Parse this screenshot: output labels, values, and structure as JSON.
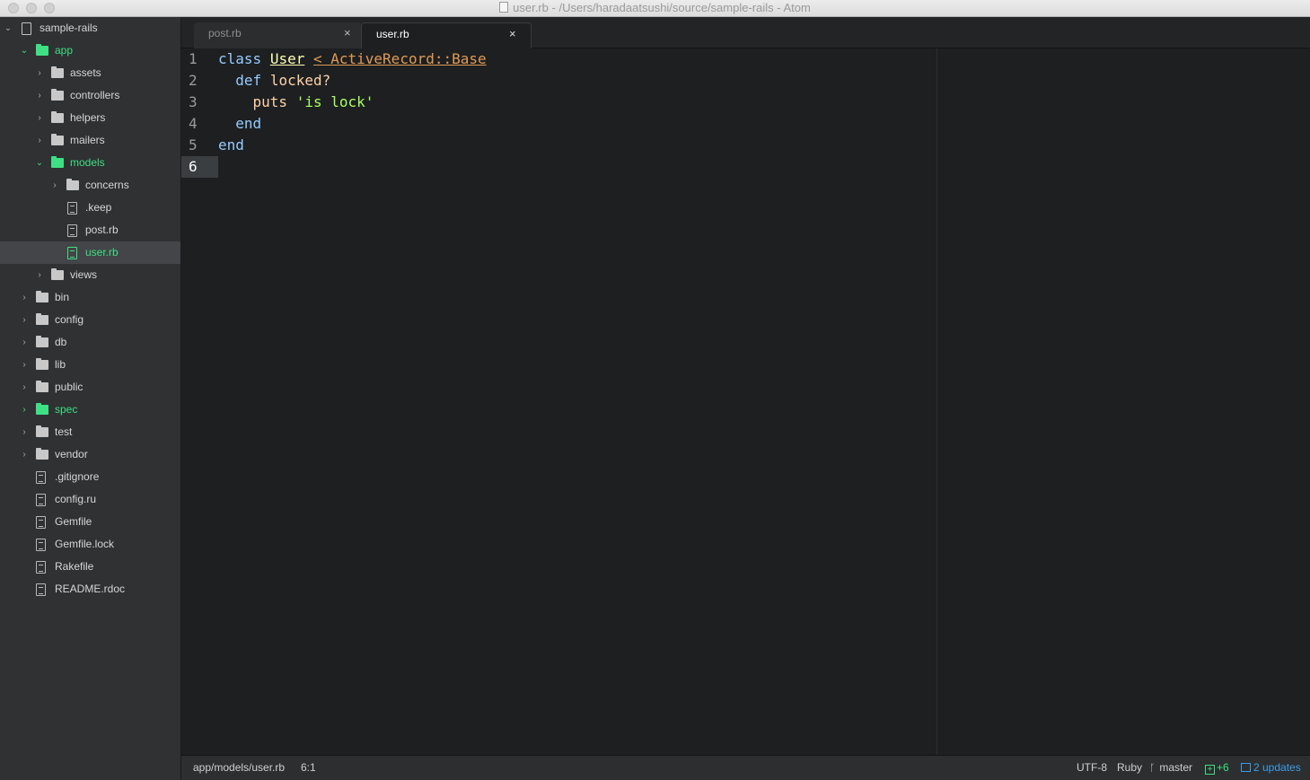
{
  "window": {
    "title": "user.rb - /Users/haradaatsushi/source/sample-rails - Atom"
  },
  "tree": {
    "root": "sample-rails",
    "items": [
      {
        "label": "app"
      },
      {
        "label": "assets"
      },
      {
        "label": "controllers"
      },
      {
        "label": "helpers"
      },
      {
        "label": "mailers"
      },
      {
        "label": "models"
      },
      {
        "label": "concerns"
      },
      {
        "label": ".keep"
      },
      {
        "label": "post.rb"
      },
      {
        "label": "user.rb"
      },
      {
        "label": "views"
      },
      {
        "label": "bin"
      },
      {
        "label": "config"
      },
      {
        "label": "db"
      },
      {
        "label": "lib"
      },
      {
        "label": "public"
      },
      {
        "label": "spec"
      },
      {
        "label": "test"
      },
      {
        "label": "vendor"
      },
      {
        "label": ".gitignore"
      },
      {
        "label": "config.ru"
      },
      {
        "label": "Gemfile"
      },
      {
        "label": "Gemfile.lock"
      },
      {
        "label": "Rakefile"
      },
      {
        "label": "README.rdoc"
      }
    ]
  },
  "tabs": [
    {
      "label": "post.rb",
      "close": "×"
    },
    {
      "label": "user.rb",
      "close": "×"
    }
  ],
  "editor": {
    "line_numbers": [
      "1",
      "2",
      "3",
      "4",
      "5",
      "6"
    ],
    "code": {
      "l1_kw": "class",
      "l1_cls": "User",
      "l1_sup": "< ActiveRecord::Base",
      "l2_kw": "def",
      "l2_fn": "locked?",
      "l3_fn": "puts",
      "l3_str": "'is lock'",
      "l4_kw": "end",
      "l5_kw": "end"
    }
  },
  "status": {
    "path": "app/models/user.rb",
    "cursor": "6:1",
    "encoding": "UTF-8",
    "grammar": "Ruby",
    "branch": "master",
    "git_added": "+6",
    "updates": "2 updates"
  },
  "colors": {
    "accent_green": "#3ee083",
    "keyword": "#96cbfe",
    "string": "#a8ff60",
    "update_blue": "#3d9de6"
  },
  "icons": {
    "folder": "folder-icon",
    "file": "file-icon",
    "repo": "repo-icon",
    "chevron": "chevron-icon"
  }
}
